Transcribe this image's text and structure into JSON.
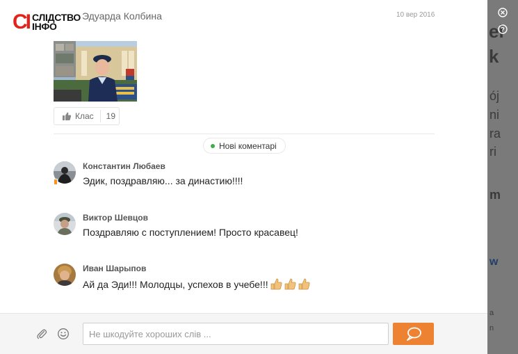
{
  "logo": {
    "mark": "СІ",
    "line1": "СЛІДСТВО",
    "line2": "ІНФО"
  },
  "post": {
    "author": "Эдуарда Колбина",
    "date": "10 вер 2016",
    "like_label": "Клас",
    "like_count": "19"
  },
  "new_comments_label": "Нові коментарі",
  "comments": [
    {
      "name": "Константин Любаев",
      "text": "Эдик, поздравляю... за династию!!!!"
    },
    {
      "name": "Виктор Шевцов",
      "text": "Поздравляю с поступлением! Просто красавец!"
    },
    {
      "name": "Иван Шарыпов",
      "text": "Ай да Эди!!! Молодцы, успехов в учебе!!!"
    }
  ],
  "composer": {
    "placeholder": "Не шкодуйте хороших слів ..."
  },
  "icons": {
    "close": "close-icon",
    "help": "help-icon",
    "attach": "paperclip-icon",
    "emoji": "smiley-icon",
    "send": "speech-bubble-icon",
    "like": "thumbs-up-icon"
  },
  "colors": {
    "accent": "#ee8233",
    "online": "#3fae49",
    "brand_red": "#e2231a"
  }
}
